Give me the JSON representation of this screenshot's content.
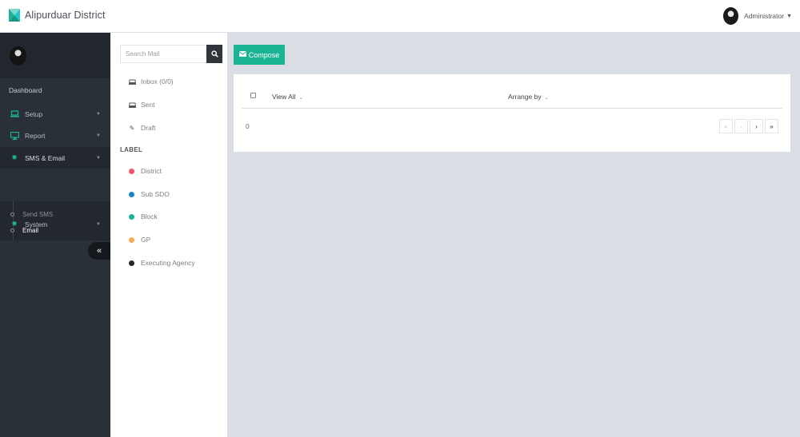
{
  "header": {
    "title": "Alipurduar District",
    "user_name": "Administrator",
    "brand_color": "#1ab394"
  },
  "sidebar": {
    "dashboard_label": "Dashboard",
    "items": [
      {
        "label": "Setup",
        "icon": "laptop-icon"
      },
      {
        "label": "Report",
        "icon": "monitor-icon"
      },
      {
        "label": "SMS & Email",
        "icon": "gear-icon"
      },
      {
        "label": "System",
        "icon": "gear-icon"
      }
    ],
    "submenu": [
      {
        "label": "Send SMS"
      },
      {
        "label": "Email"
      }
    ],
    "colors": {
      "background": "#2a3038",
      "accent": "#1ab394"
    }
  },
  "mailnav": {
    "search_placeholder": "Search Mail",
    "folders": [
      {
        "label": "Inbox (0/0)",
        "icon": "inbox-icon"
      },
      {
        "label": "Sent",
        "icon": "inbox-icon"
      },
      {
        "label": "Draft",
        "icon": "pencil-icon"
      }
    ],
    "label_title": "LABEL",
    "labels": [
      {
        "label": "District",
        "color": "#ed5565"
      },
      {
        "label": "Sub SDO",
        "color": "#1c84c6"
      },
      {
        "label": "Block",
        "color": "#1ab394"
      },
      {
        "label": "GP",
        "color": "#f8ac59"
      },
      {
        "label": "Executing Agency",
        "color": "#262626"
      }
    ]
  },
  "main": {
    "compose_label": "Compose",
    "view_all_label": "View All",
    "arrange_label": "Arrange by",
    "count": "0",
    "pager": [
      "«",
      "‹",
      "›",
      "»"
    ]
  }
}
